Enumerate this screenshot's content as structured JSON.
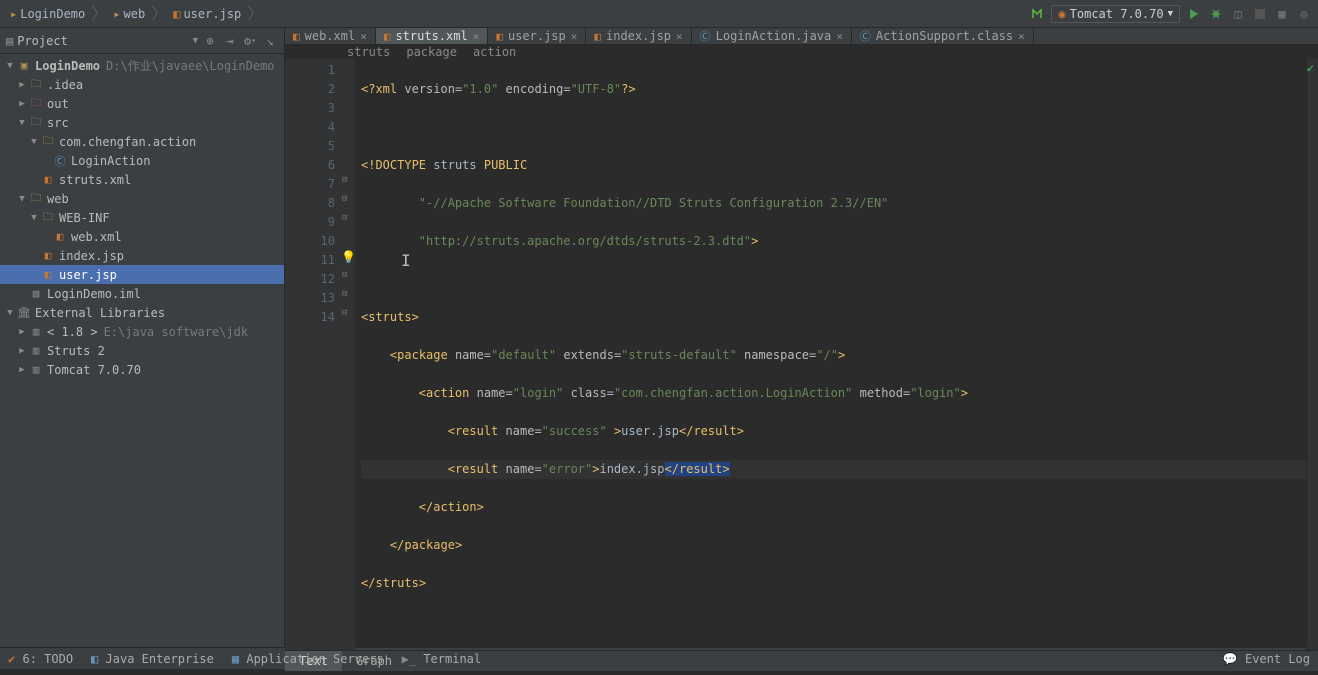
{
  "breadcrumb": {
    "parts": [
      "LoginDemo",
      "web",
      "user.jsp"
    ]
  },
  "run_config": {
    "label": "Tomcat 7.0.70"
  },
  "project": {
    "panel_title": "Project",
    "root_name": "LoginDemo",
    "root_path": "D:\\作业\\javaee\\LoginDemo",
    "idea": ".idea",
    "out": "out",
    "src": "src",
    "pkg": "com.chengfan.action",
    "login_action": "LoginAction",
    "struts_xml": "struts.xml",
    "web": "web",
    "webinf": "WEB-INF",
    "web_xml": "web.xml",
    "index_jsp": "index.jsp",
    "user_jsp": "user.jsp",
    "iml": "LoginDemo.iml",
    "ext_lib": "External Libraries",
    "jdk": "< 1.8 >",
    "jdk_path": "E:\\java software\\jdk",
    "struts2": "Struts 2",
    "tomcat": "Tomcat 7.0.70"
  },
  "tabs": [
    {
      "label": "web.xml",
      "active": false,
      "closable": true,
      "kind": "xml"
    },
    {
      "label": "struts.xml",
      "active": true,
      "closable": true,
      "kind": "xml"
    },
    {
      "label": "user.jsp",
      "active": false,
      "closable": true,
      "kind": "jsp"
    },
    {
      "label": "index.jsp",
      "active": false,
      "closable": true,
      "kind": "jsp"
    },
    {
      "label": "LoginAction.java",
      "active": false,
      "closable": true,
      "kind": "java"
    },
    {
      "label": "ActionSupport.class",
      "active": false,
      "closable": true,
      "kind": "java"
    }
  ],
  "crumbs": [
    "struts",
    "package",
    "action"
  ],
  "line_numbers": [
    "1",
    "2",
    "3",
    "4",
    "5",
    "6",
    "7",
    "8",
    "9",
    "10",
    "11",
    "12",
    "13",
    "14"
  ],
  "code_tokens": {
    "xml_decl_open": "<?",
    "xml": "xml",
    "version_attr": "version",
    "version_val": "\"1.0\"",
    "encoding_attr": "encoding",
    "encoding_val": "\"UTF-8\"",
    "xml_decl_close": "?>",
    "doctype": "<!DOCTYPE",
    "struts_kw": "struts",
    "public_kw": "PUBLIC",
    "dtd1": "\"-//Apache Software Foundation//DTD Struts Configuration 2.3//EN\"",
    "dtd2": "\"http://struts.apache.org/dtds/struts-2.3.dtd\"",
    "lt": "<",
    "gt": ">",
    "slash": "/",
    "struts_tag": "struts",
    "package_tag": "package",
    "name_attr": "name",
    "default_val": "\"default\"",
    "extends_attr": "extends",
    "struts_default_val": "\"struts-default\"",
    "namespace_attr": "namespace",
    "root_val": "\"/\"",
    "action_tag": "action",
    "login_val": "\"login\"",
    "class_attr": "class",
    "class_val": "\"com.chengfan.action.LoginAction\"",
    "method_attr": "method",
    "result_tag": "result",
    "success_val": "\"success\"",
    "user_jsp": "user.jsp",
    "error_val": "\"error\"",
    "index_jsp": "index.jsp"
  },
  "bottom_tabs": {
    "text": "Text",
    "graph": "Graph"
  },
  "status": {
    "todo": "6: TODO",
    "javaee": "Java Enterprise",
    "appsrv": "Application Servers",
    "terminal": "Terminal",
    "event_log": "Event Log"
  }
}
